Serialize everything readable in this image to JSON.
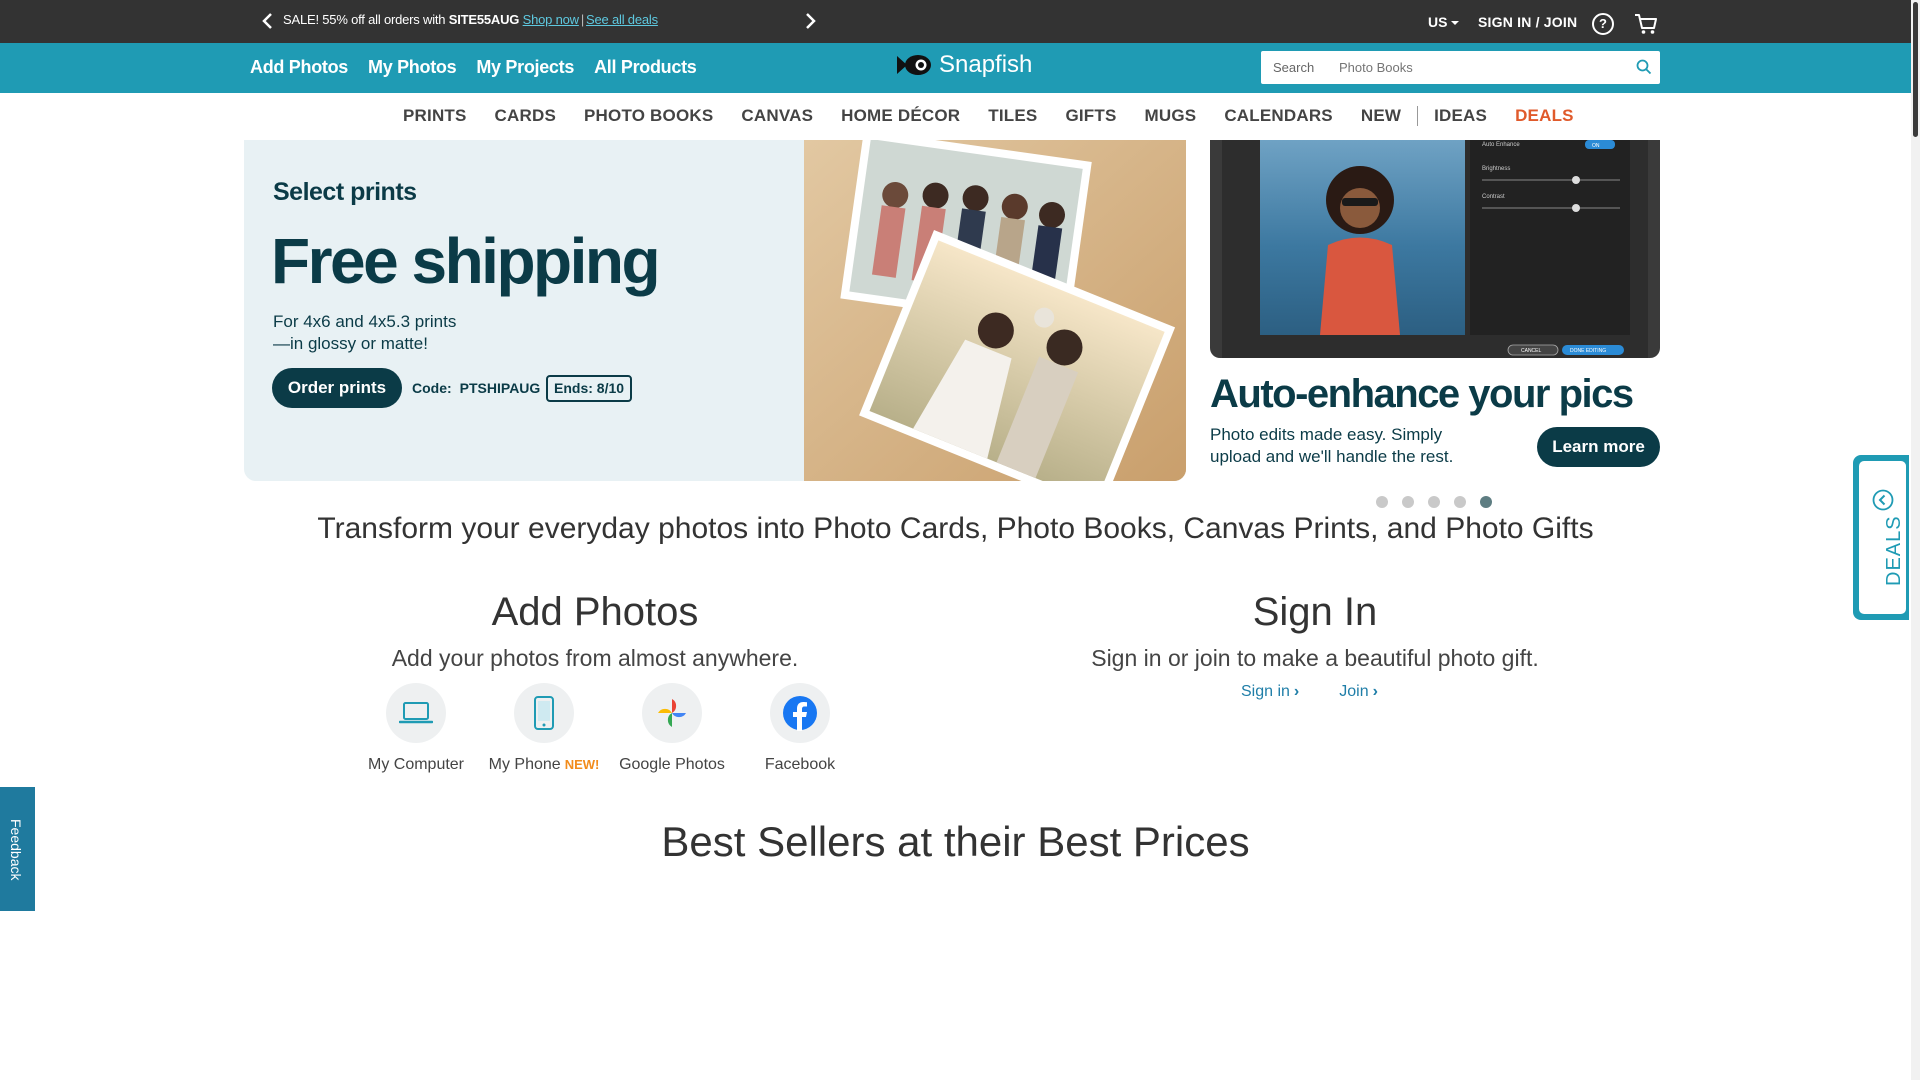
{
  "promo": {
    "prefix": "SALE! 55% off all orders with ",
    "code": "SITE55AUG",
    "shop_now": "Shop now",
    "separator": "|",
    "see_deals": "See all deals"
  },
  "topbar": {
    "region": "US",
    "signin": "SIGN IN / JOIN",
    "help": "?"
  },
  "tealnav": [
    "Add Photos",
    "My Photos",
    "My Projects",
    "All Products"
  ],
  "logo": {
    "text": "Snapfish"
  },
  "search": {
    "label": "Search",
    "placeholder": "Photo Books"
  },
  "categories": [
    "PRINTS",
    "CARDS",
    "PHOTO BOOKS",
    "CANVAS",
    "HOME DÉCOR",
    "TILES",
    "GIFTS",
    "MUGS",
    "CALENDARS",
    "NEW",
    "IDEAS",
    "DEALS"
  ],
  "banner1": {
    "eyebrow": "Select prints",
    "headline": "Free shipping",
    "sub1": "For 4x6 and 4x5.3 prints",
    "sub2": "—in glossy or matte!",
    "button": "Order prints",
    "code_label": "Code:",
    "code": "PTSHIPAUG",
    "ends": "Ends: 8/10"
  },
  "banner2": {
    "headline": "Auto-enhance your pics",
    "sub1": "Photo edits made easy. Simply",
    "sub2": "upload and we'll handle the rest.",
    "button": "Learn more",
    "panel": {
      "auto_enhance": "Auto Enhance",
      "toggle": "ON",
      "brightness": "Brightness",
      "contrast": "Contrast",
      "cancel": "CANCEL",
      "done": "DONE EDITING"
    }
  },
  "carousel": {
    "count": 5,
    "active": 4
  },
  "tagline": "Transform your everyday photos into Photo Cards, Photo Books, Canvas Prints, and Photo Gifts",
  "add_photos": {
    "title": "Add Photos",
    "subtitle": "Add your photos from almost anywhere.",
    "sources": [
      {
        "label": "My Computer",
        "icon": "laptop-icon"
      },
      {
        "label": "My Phone",
        "badge": "NEW!",
        "icon": "phone-icon"
      },
      {
        "label": "Google Photos",
        "icon": "google-photos-icon"
      },
      {
        "label": "Facebook",
        "icon": "facebook-icon"
      }
    ]
  },
  "sign_in": {
    "title": "Sign In",
    "subtitle": "Sign in or join to make a beautiful photo gift.",
    "signin_link": "Sign in",
    "join_link": "Join"
  },
  "bestsellers": "Best Sellers at their Best Prices",
  "deals_tab": "DEALS",
  "feedback_tab": "Feedback",
  "colors": {
    "teal": "#1f9bb4",
    "dark": "#333333",
    "navy": "#0b3b47",
    "deals": "#e05a2b",
    "new_badge": "#f28c1c"
  }
}
